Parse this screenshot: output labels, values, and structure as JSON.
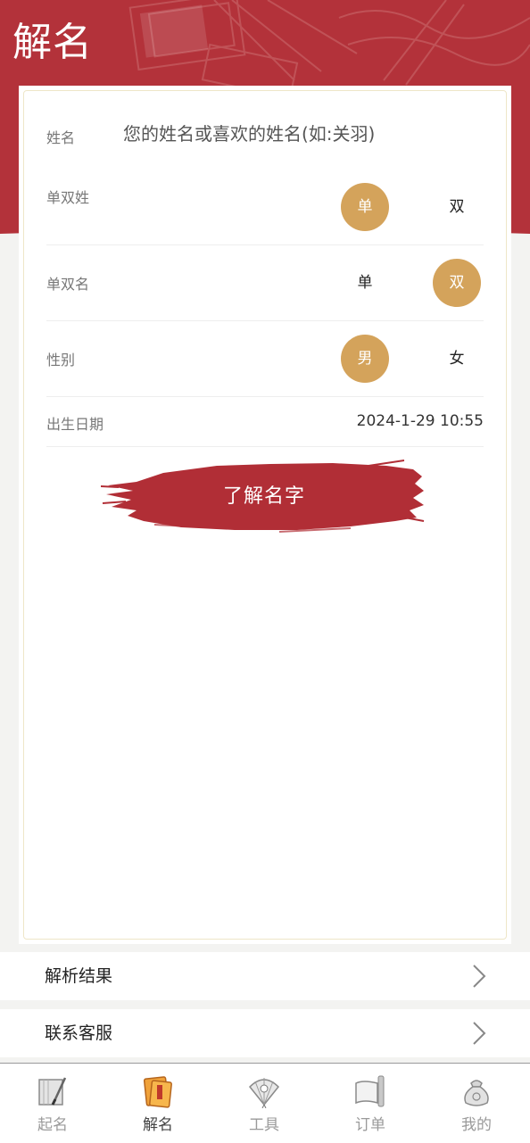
{
  "header": {
    "title": "解名",
    "background_color": "#b3323a"
  },
  "form": {
    "name": {
      "label": "姓名",
      "placeholder": "您的姓名或喜欢的姓名(如:关羽)",
      "value": ""
    },
    "surname_type": {
      "label": "单双姓",
      "options": [
        "单",
        "双"
      ],
      "selected": "单"
    },
    "given_name_type": {
      "label": "单双名",
      "options": [
        "单",
        "双"
      ],
      "selected": "双"
    },
    "gender": {
      "label": "性别",
      "options": [
        "男",
        "女"
      ],
      "selected": "男"
    },
    "birth_date": {
      "label": "出生日期",
      "value": "2024-1-29 10:55"
    },
    "submit_label": "了解名字",
    "accent_color": "#d4a35b",
    "button_color": "#b12e36"
  },
  "links": [
    {
      "label": "解析结果",
      "icon": "chevron-right-icon"
    },
    {
      "label": "联系客服",
      "icon": "chevron-right-icon"
    }
  ],
  "tabbar": {
    "active": "解名",
    "tabs": [
      {
        "label": "起名",
        "icon": "notebook-brush-icon"
      },
      {
        "label": "解名",
        "icon": "scroll-book-icon"
      },
      {
        "label": "工具",
        "icon": "fan-icon"
      },
      {
        "label": "订单",
        "icon": "paper-scroll-icon"
      },
      {
        "label": "我的",
        "icon": "money-bag-icon"
      }
    ]
  }
}
